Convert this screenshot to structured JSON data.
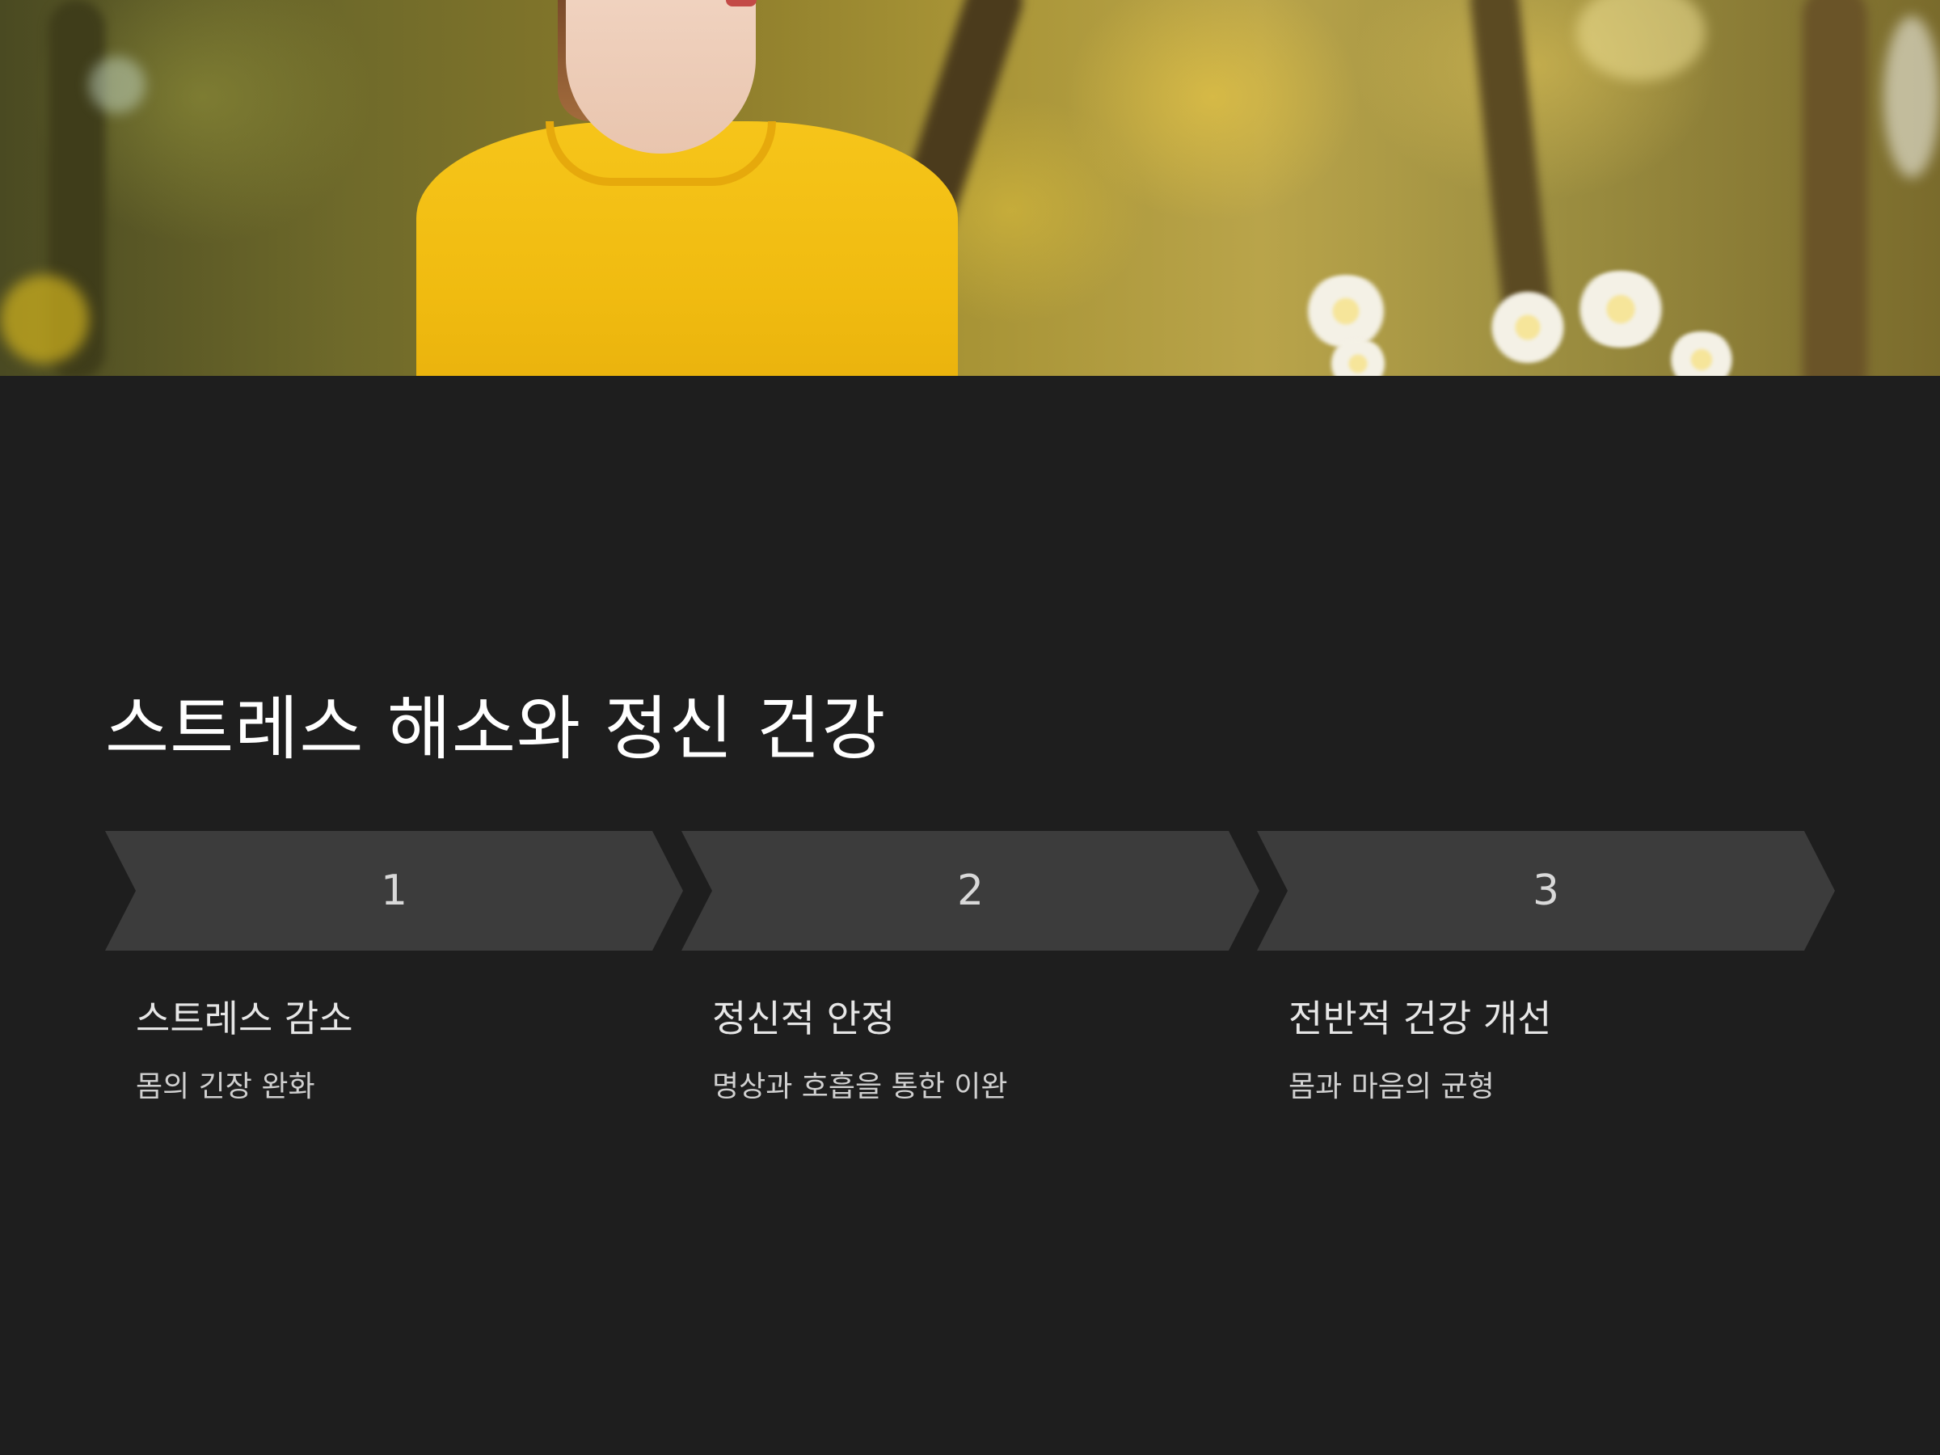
{
  "slide": {
    "title": "스트레스 해소와 정신 건강"
  },
  "steps": [
    {
      "number": "1",
      "title": "스트레스 감소",
      "description": "몸의 긴장 완화"
    },
    {
      "number": "2",
      "title": "정신적 안정",
      "description": "명상과 호흡을 통한 이완"
    },
    {
      "number": "3",
      "title": "전반적 건강 개선",
      "description": "몸과 마음의 균형"
    }
  ],
  "colors": {
    "background": "#1e1e1e",
    "chevron": "#3c3c3c",
    "shirt": "#f0bb10",
    "title_text": "#ffffff"
  }
}
